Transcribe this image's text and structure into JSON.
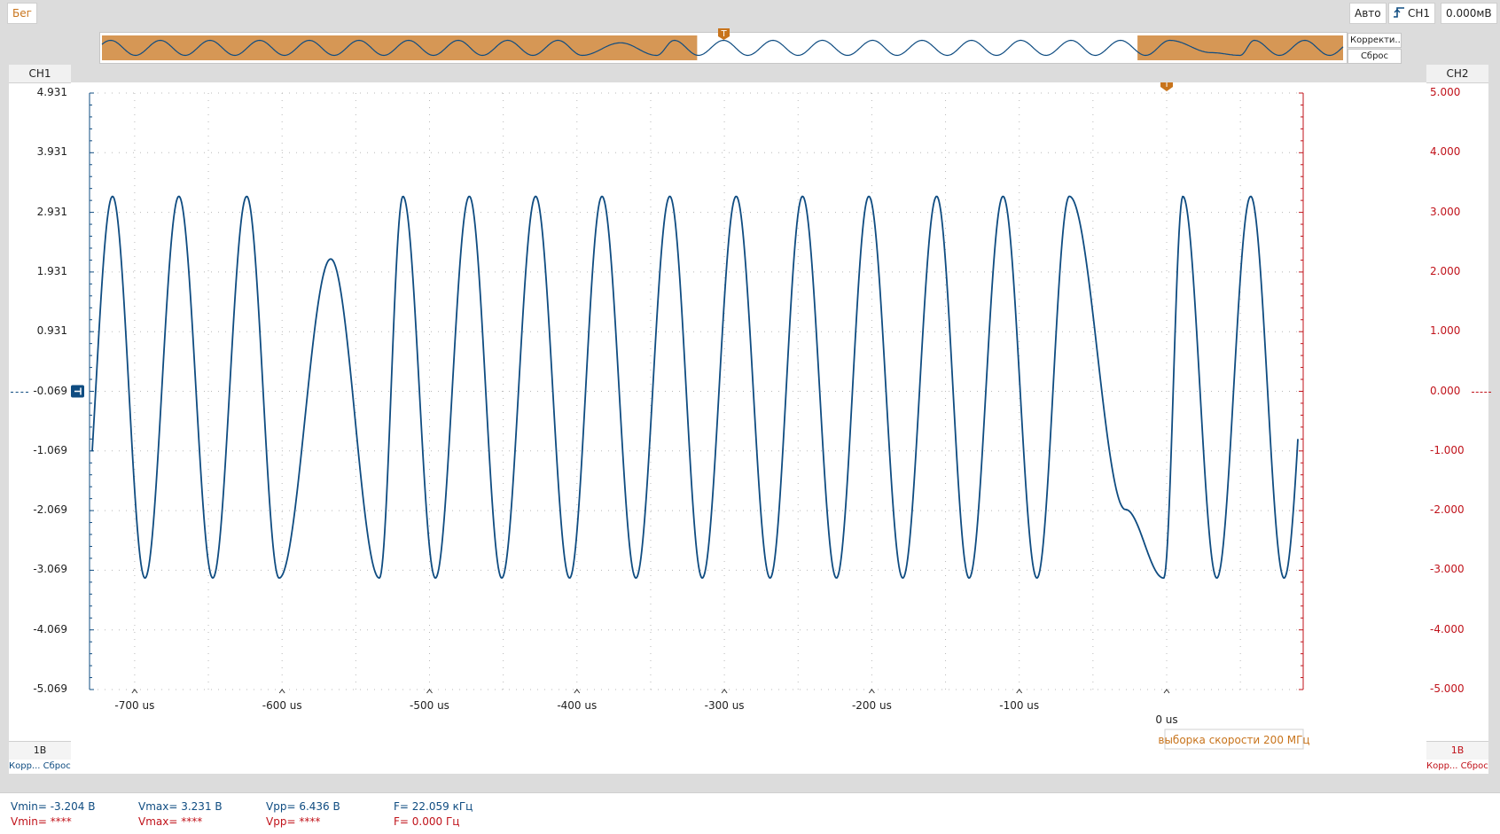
{
  "topbar": {
    "run_state": "Бег",
    "mode": "Авто",
    "trigger_channel": "CH1",
    "trigger_level": "0.000мВ",
    "trigger_edge_icon": "rising-edge-icon"
  },
  "overview": {
    "adjust_label": "Корректи...",
    "reset_label": "Сброс"
  },
  "ch1": {
    "title": "CH1",
    "scale": "1В",
    "adjust_label": "Корр...",
    "reset_label": "Сброс",
    "color": "#0f4c81",
    "y_ticks": [
      "4.931",
      "3.931",
      "2.931",
      "1.931",
      "0.931",
      "-0.069",
      "-1.069",
      "-2.069",
      "-3.069",
      "-4.069",
      "-5.069"
    ]
  },
  "ch2": {
    "title": "CH2",
    "scale": "1В",
    "adjust_label": "Корр...",
    "reset_label": "Сброс",
    "color": "#c0121a",
    "y_ticks": [
      "5.000",
      "4.000",
      "3.000",
      "2.000",
      "1.000",
      "0.000",
      "-1.000",
      "-2.000",
      "-3.000",
      "-4.000",
      "-5.000"
    ]
  },
  "plot": {
    "grid_color": "#b8b8b8",
    "trigger_marker": "T",
    "trigger_color": "#c8741c",
    "x_ticks": [
      "-700 us",
      "-600 us",
      "-500 us",
      "-400 us",
      "-300 us",
      "-200 us",
      "-100 us"
    ],
    "x_zero_label": "0 us",
    "sample_rate": "выборка скорости 200 МГц"
  },
  "chart_data": {
    "type": "line",
    "title": "",
    "xlabel": "",
    "ylabel": "",
    "x_unit": "us",
    "xlim": [
      -730,
      92
    ],
    "ylim": [
      -5.069,
      4.931
    ],
    "series": [
      {
        "name": "CH1",
        "waveform": "sine",
        "amplitude": 3.2,
        "offset": 0.0,
        "period_us": 45.3,
        "peak_times_us": [
          -715,
          -670,
          -624,
          -518,
          -473,
          -428,
          -383,
          -337,
          -292,
          -247,
          -202,
          -156,
          -111,
          -66,
          11,
          57
        ],
        "trough_times_us": [
          -693,
          -647,
          -602,
          -534,
          -496,
          -451,
          -405,
          -360,
          -315,
          -269,
          -224,
          -179,
          -134,
          -88,
          -2,
          34
        ],
        "glitches": [
          {
            "t_us": -567,
            "value": 2.15,
            "note": "dip between maxima"
          },
          {
            "t_us": -28,
            "value": -2.05,
            "note": "bump between minima"
          }
        ]
      }
    ]
  },
  "measurements": {
    "ch1": {
      "vmin": "Vmin= -3.204 В",
      "vmax": "Vmax= 3.231 В",
      "vpp": "Vpp= 6.436 В",
      "freq": "F= 22.059 кГц"
    },
    "ch2": {
      "vmin": "Vmin= ****",
      "vmax": "Vmax= ****",
      "vpp": "Vpp= ****",
      "freq": "F= 0.000 Гц"
    }
  }
}
